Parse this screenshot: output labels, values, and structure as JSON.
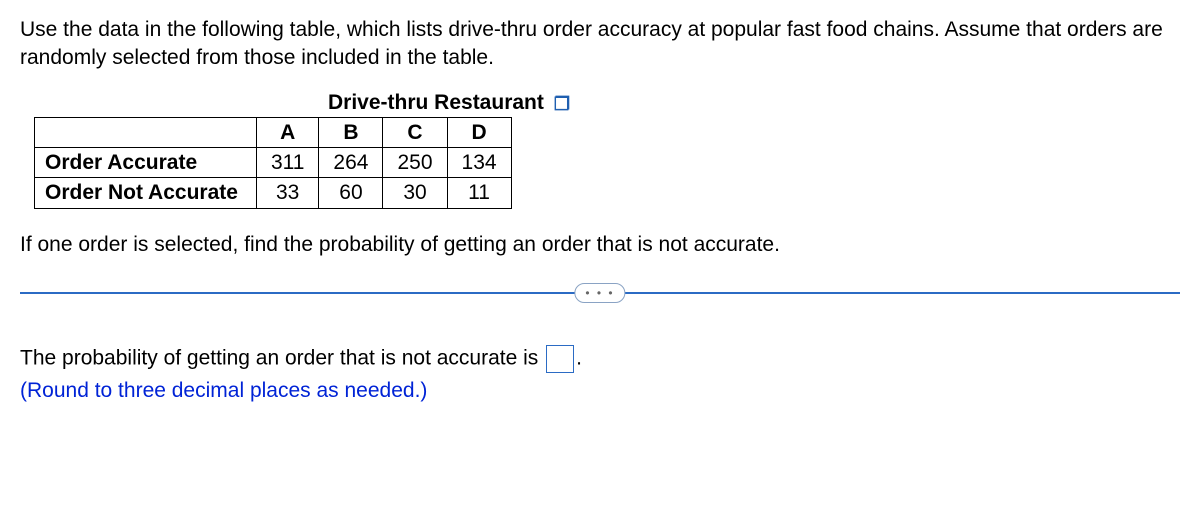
{
  "intro": "Use the data in the following table, which lists drive-thru order accuracy at popular fast food chains. Assume that orders are randomly selected from those included in the table.",
  "table": {
    "title": "Drive-thru Restaurant",
    "columns": [
      "A",
      "B",
      "C",
      "D"
    ],
    "rows": [
      {
        "label": "Order Accurate",
        "values": [
          311,
          264,
          250,
          134
        ]
      },
      {
        "label": "Order Not Accurate",
        "values": [
          33,
          60,
          30,
          11
        ]
      }
    ]
  },
  "question": "If one order is selected, find the probability of getting an order that is not accurate.",
  "divider_dots": "• • •",
  "answer": {
    "prefix": "The probability of getting an order that is not accurate is ",
    "value": "",
    "suffix": ".",
    "note": "(Round to three decimal places as needed.)"
  },
  "chart_data": {
    "type": "table",
    "title": "Drive-thru Restaurant",
    "columns": [
      "",
      "A",
      "B",
      "C",
      "D"
    ],
    "rows": [
      [
        "Order Accurate",
        311,
        264,
        250,
        134
      ],
      [
        "Order Not Accurate",
        33,
        60,
        30,
        11
      ]
    ]
  }
}
